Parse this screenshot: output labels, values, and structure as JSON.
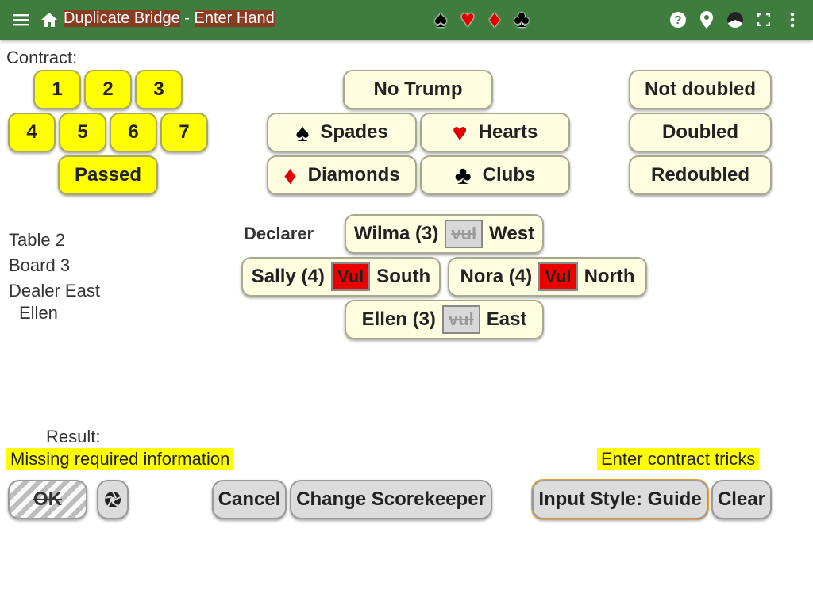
{
  "header": {
    "title_hl1": "Duplicate Bridge",
    "title_sep": " - ",
    "title_hl2": "Enter Hand",
    "suits": [
      "♠",
      "♥",
      "♦",
      "♣"
    ],
    "icons": [
      "menu-icon",
      "home-icon",
      "help-icon",
      "location-icon",
      "pie-chart-icon",
      "fullscreen-icon",
      "more-vert-icon"
    ]
  },
  "contract": {
    "label": "Contract:",
    "levels": [
      "1",
      "2",
      "3",
      "4",
      "5",
      "6",
      "7"
    ],
    "passed": "Passed",
    "no_trump": "No Trump",
    "suits": [
      {
        "symbol": "♠",
        "name": "Spades"
      },
      {
        "symbol": "♥",
        "name": "Hearts"
      },
      {
        "symbol": "♦",
        "name": "Diamonds"
      },
      {
        "symbol": "♣",
        "name": "Clubs"
      }
    ],
    "doubles": [
      "Not doubled",
      "Doubled",
      "Redoubled"
    ]
  },
  "info": {
    "table": "Table 2",
    "board": "Board 3",
    "dealer": "Dealer East",
    "dealer_name": "Ellen"
  },
  "declarer": {
    "label": "Declarer",
    "west": {
      "player": "Wilma (3)",
      "vul": "vul",
      "dir": "West"
    },
    "south": {
      "player": "Sally (4)",
      "vul": "Vul",
      "dir": "South"
    },
    "north": {
      "player": "Nora (4)",
      "vul": "Vul",
      "dir": "North"
    },
    "east": {
      "player": "Ellen (3)",
      "vul": "vul",
      "dir": "East"
    }
  },
  "result": {
    "label": "Result:",
    "missing": "Missing required information",
    "enter_tricks": "Enter contract tricks"
  },
  "actions": {
    "ok": "OK",
    "cancel": "Cancel",
    "change_scorekeeper": "Change Scorekeeper",
    "input_style": "Input Style: Guide",
    "clear": "Clear"
  },
  "colors": {
    "header_bg": "#3f7d3f",
    "selected_yellow": "#ffff00",
    "vulnerable_red": "#ee0000"
  }
}
